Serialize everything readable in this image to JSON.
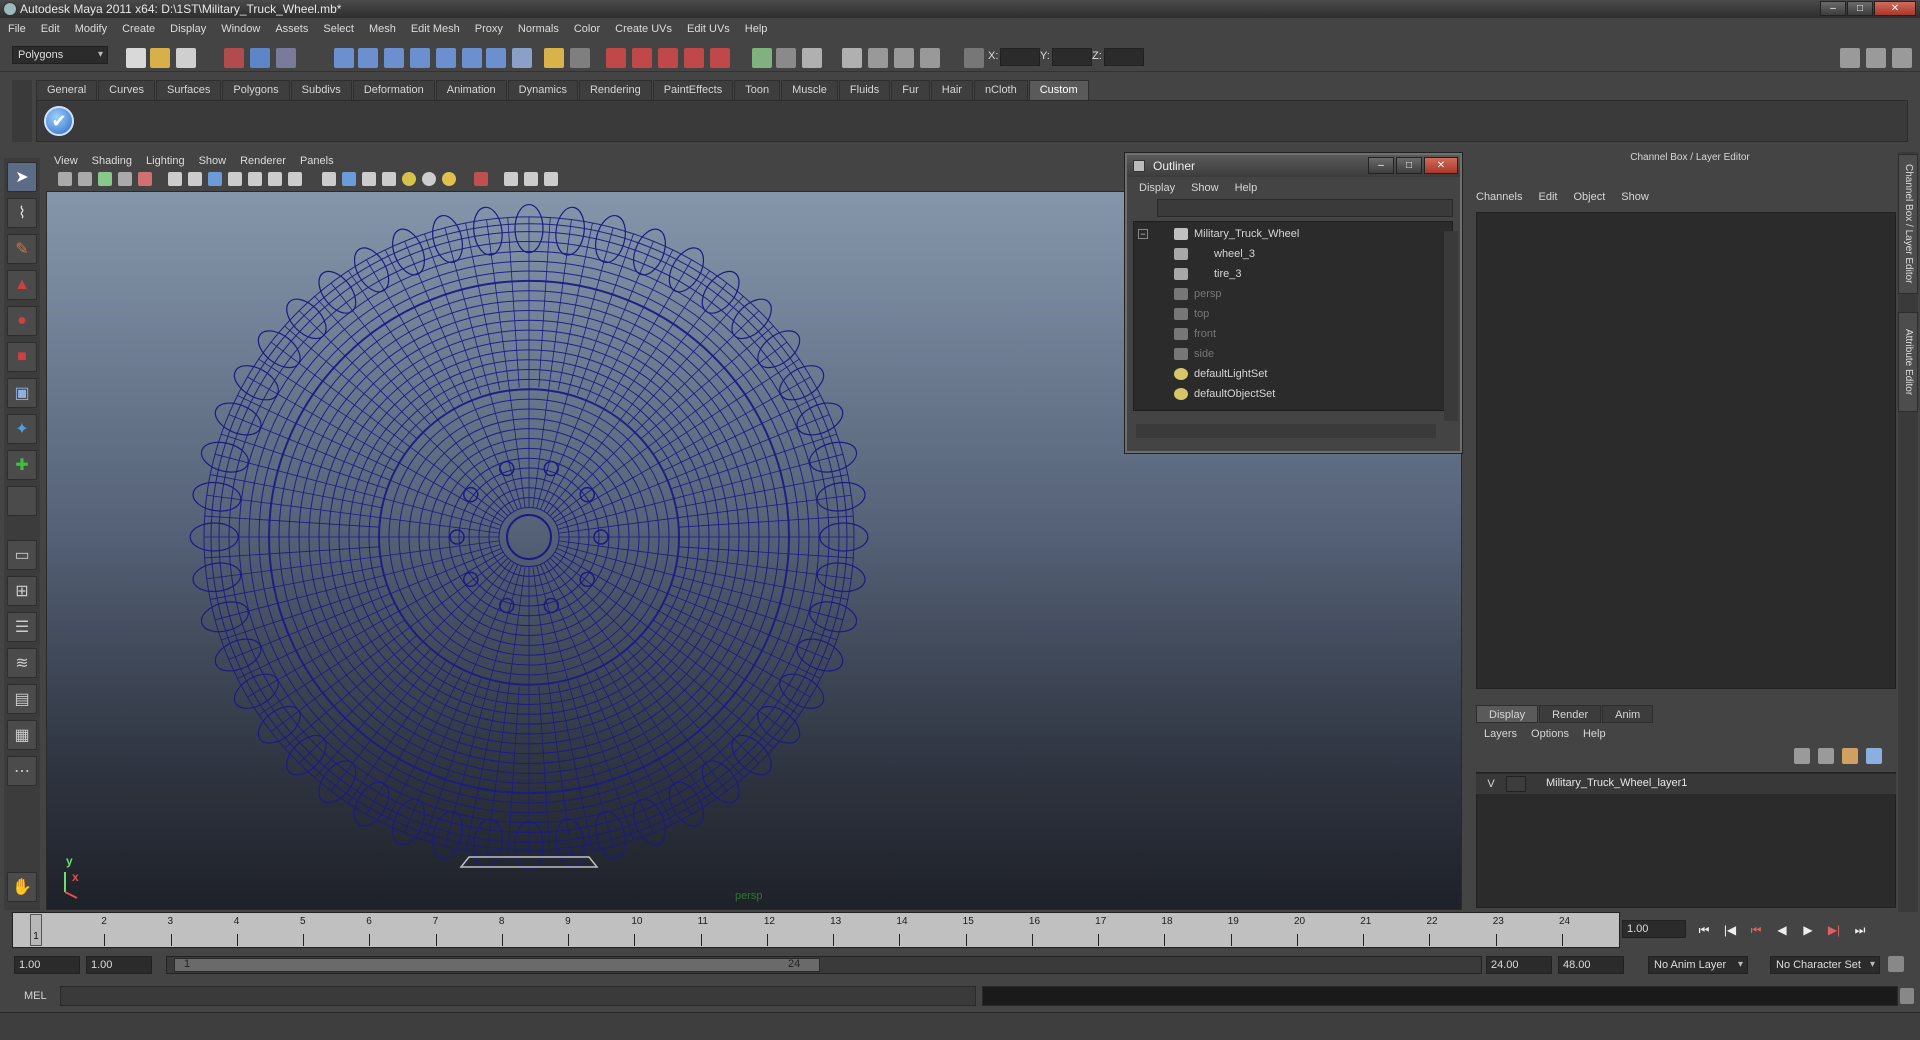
{
  "window": {
    "title": "Autodesk Maya 2011 x64: D:\\1ST\\Military_Truck_Wheel.mb*",
    "buttons": {
      "minimize": "–",
      "maximize": "□",
      "close": "✕"
    }
  },
  "menubar": [
    "File",
    "Edit",
    "Modify",
    "Create",
    "Display",
    "Window",
    "Assets",
    "Select",
    "Mesh",
    "Edit Mesh",
    "Proxy",
    "Normals",
    "Color",
    "Create UVs",
    "Edit UVs",
    "Help"
  ],
  "statusline": {
    "menuset": "Polygons",
    "x_label": "X:",
    "y_label": "Y:",
    "z_label": "Z:"
  },
  "shelf": {
    "tabs": [
      "General",
      "Curves",
      "Surfaces",
      "Polygons",
      "Subdivs",
      "Deformation",
      "Animation",
      "Dynamics",
      "Rendering",
      "PaintEffects",
      "Toon",
      "Muscle",
      "Fluids",
      "Fur",
      "Hair",
      "nCloth",
      "Custom"
    ],
    "active_tab": "Custom",
    "check_glyph": "✔"
  },
  "viewport": {
    "menu": [
      "View",
      "Shading",
      "Lighting",
      "Show",
      "Renderer",
      "Panels"
    ],
    "camera_label": "persp",
    "axis_y": "y",
    "axis_x": "x",
    "wire_color": "#1b1b86"
  },
  "outliner": {
    "title": "Outliner",
    "menu": [
      "Display",
      "Show",
      "Help"
    ],
    "items": [
      {
        "label": "Military_Truck_Wheel",
        "dim": false
      },
      {
        "label": "wheel_3",
        "dim": false
      },
      {
        "label": "tire_3",
        "dim": false
      },
      {
        "label": "persp",
        "dim": true
      },
      {
        "label": "top",
        "dim": true
      },
      {
        "label": "front",
        "dim": true
      },
      {
        "label": "side",
        "dim": true
      },
      {
        "label": "defaultLightSet",
        "dim": false
      },
      {
        "label": "defaultObjectSet",
        "dim": false
      }
    ],
    "collapse_glyph": "−"
  },
  "channelbox": {
    "title": "Channel Box / Layer Editor",
    "menu": [
      "Channels",
      "Edit",
      "Object",
      "Show"
    ],
    "side_tabs": [
      "Channel Box / Layer Editor",
      "Attribute Editor"
    ]
  },
  "layereditor": {
    "tabs": [
      "Display",
      "Render",
      "Anim"
    ],
    "active_tab": "Display",
    "menu": [
      "Layers",
      "Options",
      "Help"
    ],
    "layer": {
      "visible": "V",
      "name": "Military_Truck_Wheel_layer1"
    }
  },
  "timeslider": {
    "ticks": [
      "1",
      "2",
      "3",
      "4",
      "5",
      "6",
      "7",
      "8",
      "9",
      "10",
      "11",
      "12",
      "13",
      "14",
      "15",
      "16",
      "17",
      "18",
      "19",
      "20",
      "21",
      "22",
      "23",
      "24"
    ],
    "current_frame_label": "1",
    "current_frame": "1.00",
    "playback": [
      "⏮",
      "|◀",
      "⏮",
      "◀",
      "▶",
      "▶|",
      "⏭"
    ]
  },
  "rangeslider": {
    "start_time": "1.00",
    "playback_start": "1.00",
    "range_start": "1",
    "range_end": "24",
    "playback_end": "24.00",
    "end_time": "48.00",
    "anim_layer": "No Anim Layer",
    "character_set": "No Character Set"
  },
  "commandline": {
    "label": "MEL"
  }
}
